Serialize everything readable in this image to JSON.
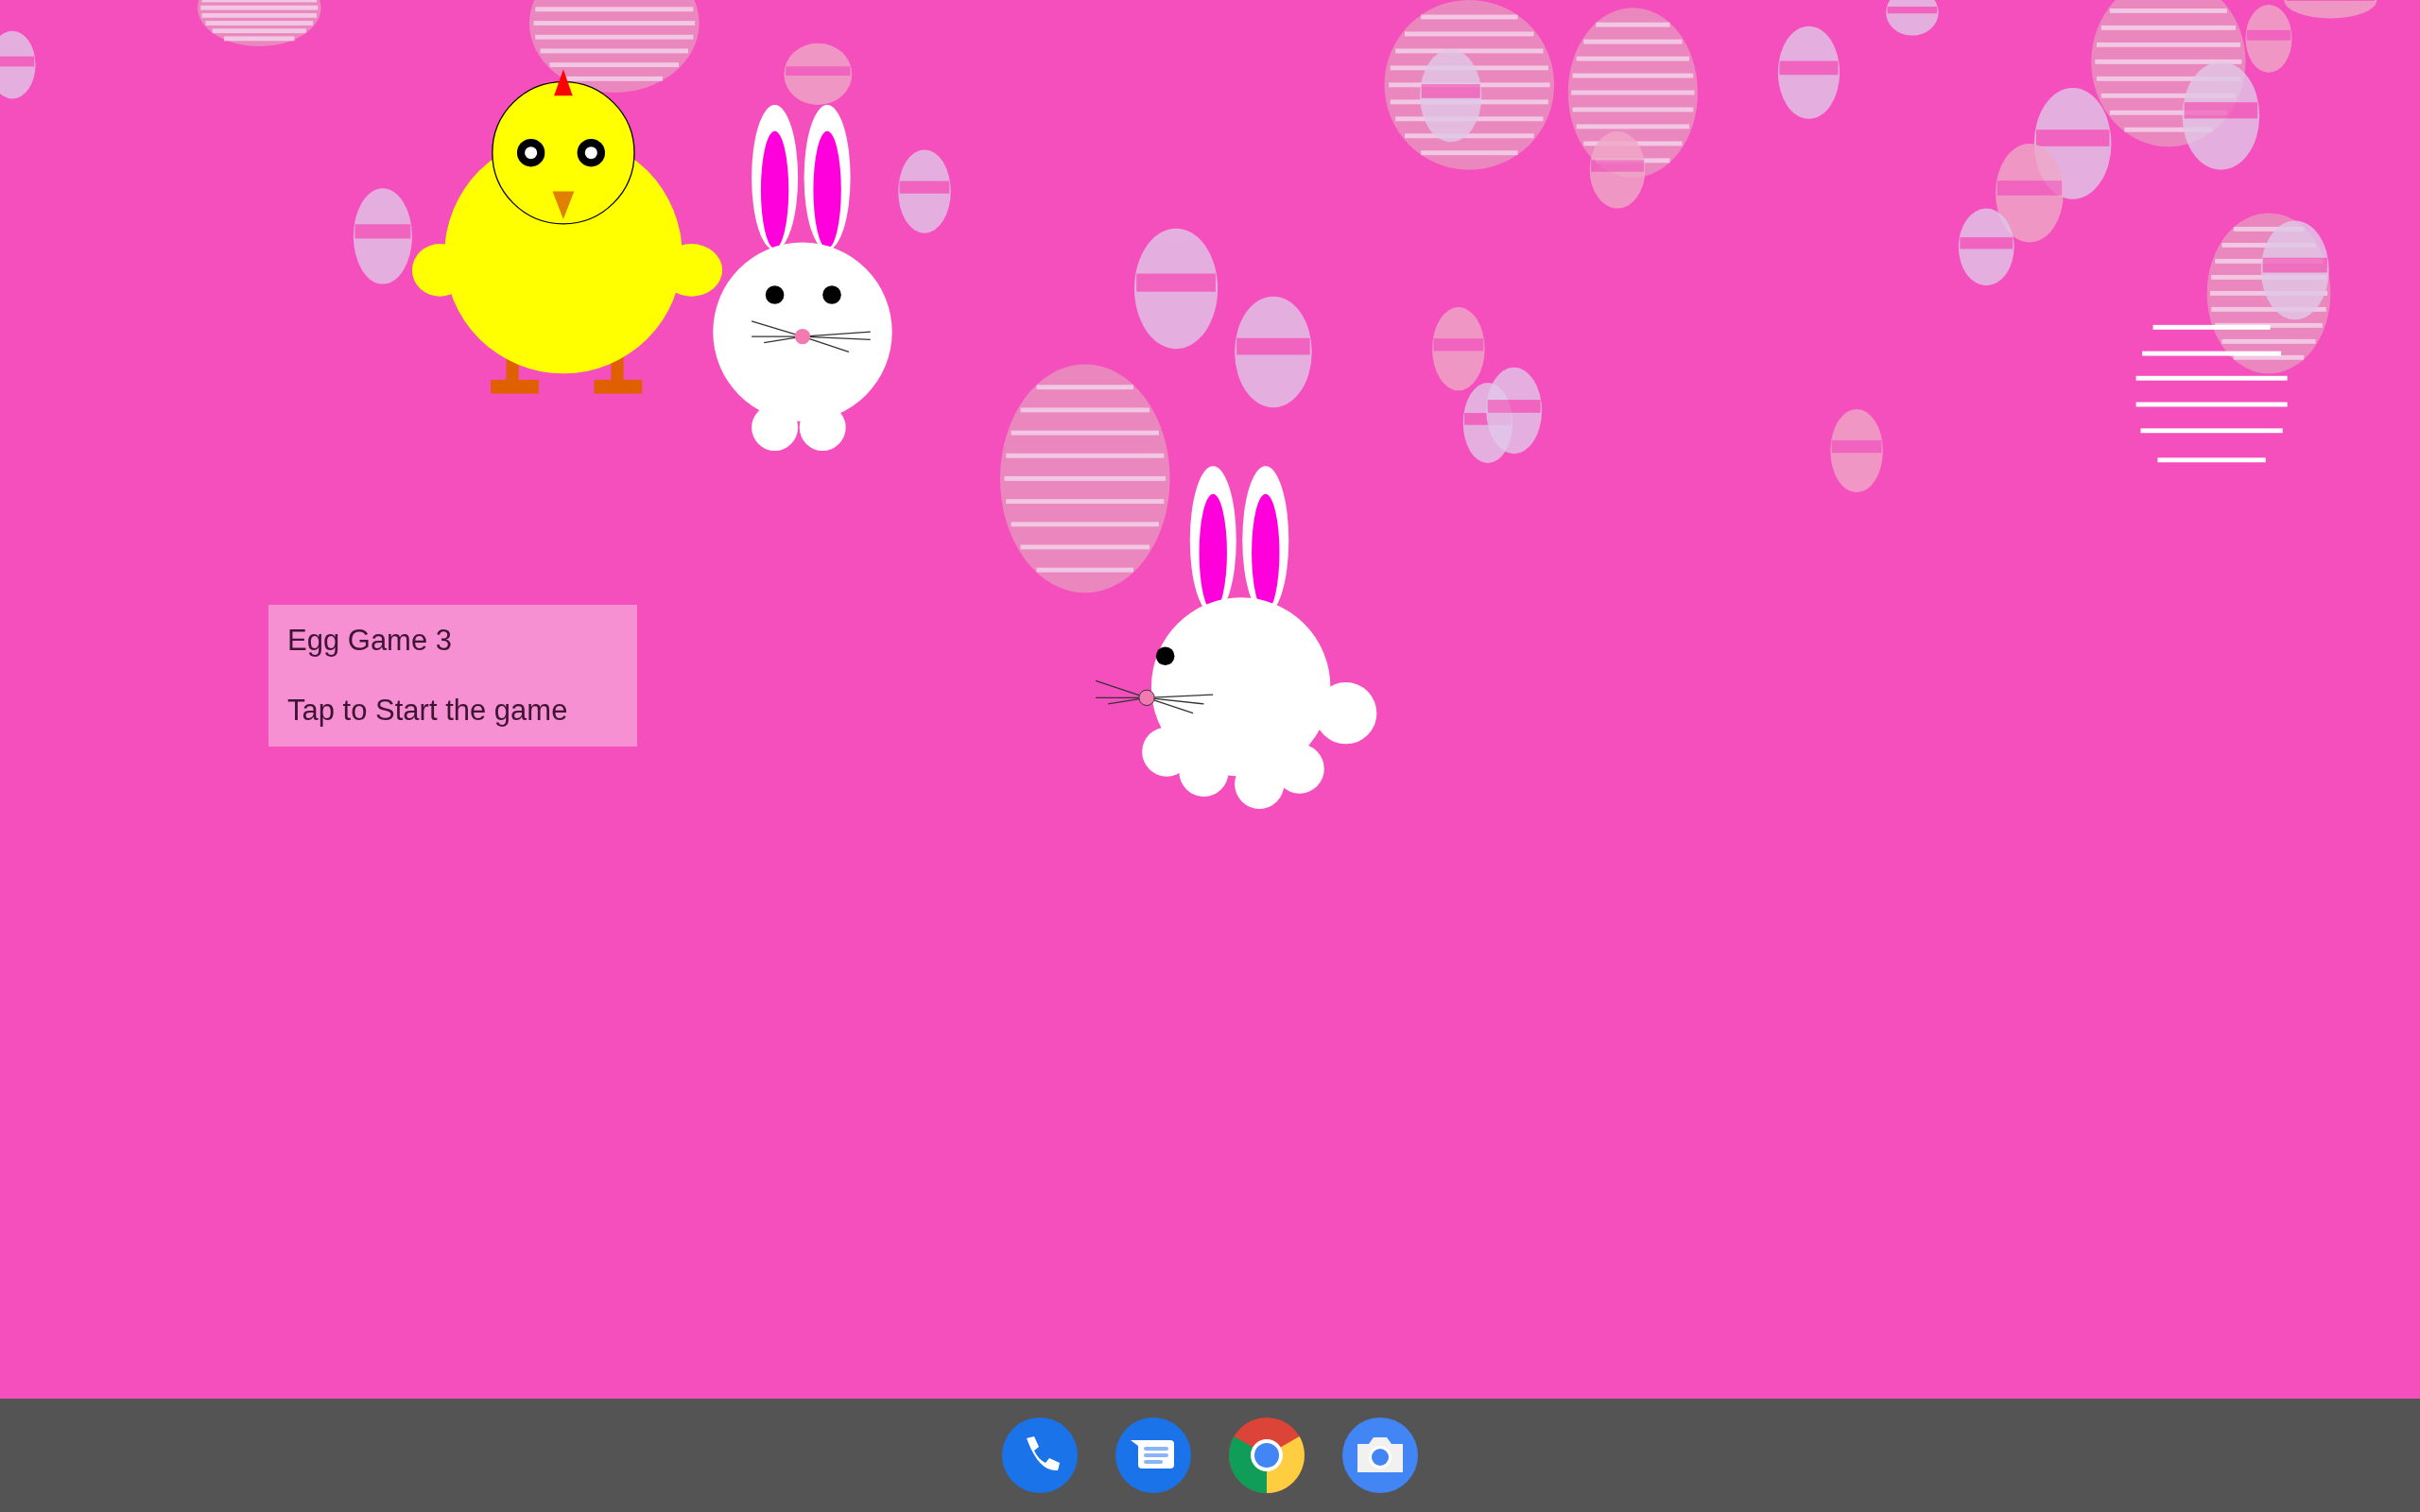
{
  "start_panel": {
    "title": "Egg Game 3",
    "prompt": "Tap to Start the game"
  }
}
